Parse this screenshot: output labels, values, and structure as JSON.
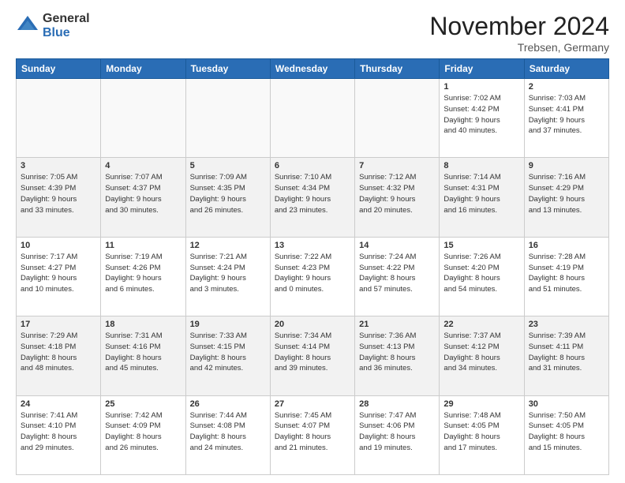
{
  "header": {
    "logo_general": "General",
    "logo_blue": "Blue",
    "month_title": "November 2024",
    "location": "Trebsen, Germany"
  },
  "days_of_week": [
    "Sunday",
    "Monday",
    "Tuesday",
    "Wednesday",
    "Thursday",
    "Friday",
    "Saturday"
  ],
  "weeks": [
    [
      {
        "day": "",
        "info": ""
      },
      {
        "day": "",
        "info": ""
      },
      {
        "day": "",
        "info": ""
      },
      {
        "day": "",
        "info": ""
      },
      {
        "day": "",
        "info": ""
      },
      {
        "day": "1",
        "info": "Sunrise: 7:02 AM\nSunset: 4:42 PM\nDaylight: 9 hours\nand 40 minutes."
      },
      {
        "day": "2",
        "info": "Sunrise: 7:03 AM\nSunset: 4:41 PM\nDaylight: 9 hours\nand 37 minutes."
      }
    ],
    [
      {
        "day": "3",
        "info": "Sunrise: 7:05 AM\nSunset: 4:39 PM\nDaylight: 9 hours\nand 33 minutes."
      },
      {
        "day": "4",
        "info": "Sunrise: 7:07 AM\nSunset: 4:37 PM\nDaylight: 9 hours\nand 30 minutes."
      },
      {
        "day": "5",
        "info": "Sunrise: 7:09 AM\nSunset: 4:35 PM\nDaylight: 9 hours\nand 26 minutes."
      },
      {
        "day": "6",
        "info": "Sunrise: 7:10 AM\nSunset: 4:34 PM\nDaylight: 9 hours\nand 23 minutes."
      },
      {
        "day": "7",
        "info": "Sunrise: 7:12 AM\nSunset: 4:32 PM\nDaylight: 9 hours\nand 20 minutes."
      },
      {
        "day": "8",
        "info": "Sunrise: 7:14 AM\nSunset: 4:31 PM\nDaylight: 9 hours\nand 16 minutes."
      },
      {
        "day": "9",
        "info": "Sunrise: 7:16 AM\nSunset: 4:29 PM\nDaylight: 9 hours\nand 13 minutes."
      }
    ],
    [
      {
        "day": "10",
        "info": "Sunrise: 7:17 AM\nSunset: 4:27 PM\nDaylight: 9 hours\nand 10 minutes."
      },
      {
        "day": "11",
        "info": "Sunrise: 7:19 AM\nSunset: 4:26 PM\nDaylight: 9 hours\nand 6 minutes."
      },
      {
        "day": "12",
        "info": "Sunrise: 7:21 AM\nSunset: 4:24 PM\nDaylight: 9 hours\nand 3 minutes."
      },
      {
        "day": "13",
        "info": "Sunrise: 7:22 AM\nSunset: 4:23 PM\nDaylight: 9 hours\nand 0 minutes."
      },
      {
        "day": "14",
        "info": "Sunrise: 7:24 AM\nSunset: 4:22 PM\nDaylight: 8 hours\nand 57 minutes."
      },
      {
        "day": "15",
        "info": "Sunrise: 7:26 AM\nSunset: 4:20 PM\nDaylight: 8 hours\nand 54 minutes."
      },
      {
        "day": "16",
        "info": "Sunrise: 7:28 AM\nSunset: 4:19 PM\nDaylight: 8 hours\nand 51 minutes."
      }
    ],
    [
      {
        "day": "17",
        "info": "Sunrise: 7:29 AM\nSunset: 4:18 PM\nDaylight: 8 hours\nand 48 minutes."
      },
      {
        "day": "18",
        "info": "Sunrise: 7:31 AM\nSunset: 4:16 PM\nDaylight: 8 hours\nand 45 minutes."
      },
      {
        "day": "19",
        "info": "Sunrise: 7:33 AM\nSunset: 4:15 PM\nDaylight: 8 hours\nand 42 minutes."
      },
      {
        "day": "20",
        "info": "Sunrise: 7:34 AM\nSunset: 4:14 PM\nDaylight: 8 hours\nand 39 minutes."
      },
      {
        "day": "21",
        "info": "Sunrise: 7:36 AM\nSunset: 4:13 PM\nDaylight: 8 hours\nand 36 minutes."
      },
      {
        "day": "22",
        "info": "Sunrise: 7:37 AM\nSunset: 4:12 PM\nDaylight: 8 hours\nand 34 minutes."
      },
      {
        "day": "23",
        "info": "Sunrise: 7:39 AM\nSunset: 4:11 PM\nDaylight: 8 hours\nand 31 minutes."
      }
    ],
    [
      {
        "day": "24",
        "info": "Sunrise: 7:41 AM\nSunset: 4:10 PM\nDaylight: 8 hours\nand 29 minutes."
      },
      {
        "day": "25",
        "info": "Sunrise: 7:42 AM\nSunset: 4:09 PM\nDaylight: 8 hours\nand 26 minutes."
      },
      {
        "day": "26",
        "info": "Sunrise: 7:44 AM\nSunset: 4:08 PM\nDaylight: 8 hours\nand 24 minutes."
      },
      {
        "day": "27",
        "info": "Sunrise: 7:45 AM\nSunset: 4:07 PM\nDaylight: 8 hours\nand 21 minutes."
      },
      {
        "day": "28",
        "info": "Sunrise: 7:47 AM\nSunset: 4:06 PM\nDaylight: 8 hours\nand 19 minutes."
      },
      {
        "day": "29",
        "info": "Sunrise: 7:48 AM\nSunset: 4:05 PM\nDaylight: 8 hours\nand 17 minutes."
      },
      {
        "day": "30",
        "info": "Sunrise: 7:50 AM\nSunset: 4:05 PM\nDaylight: 8 hours\nand 15 minutes."
      }
    ]
  ]
}
